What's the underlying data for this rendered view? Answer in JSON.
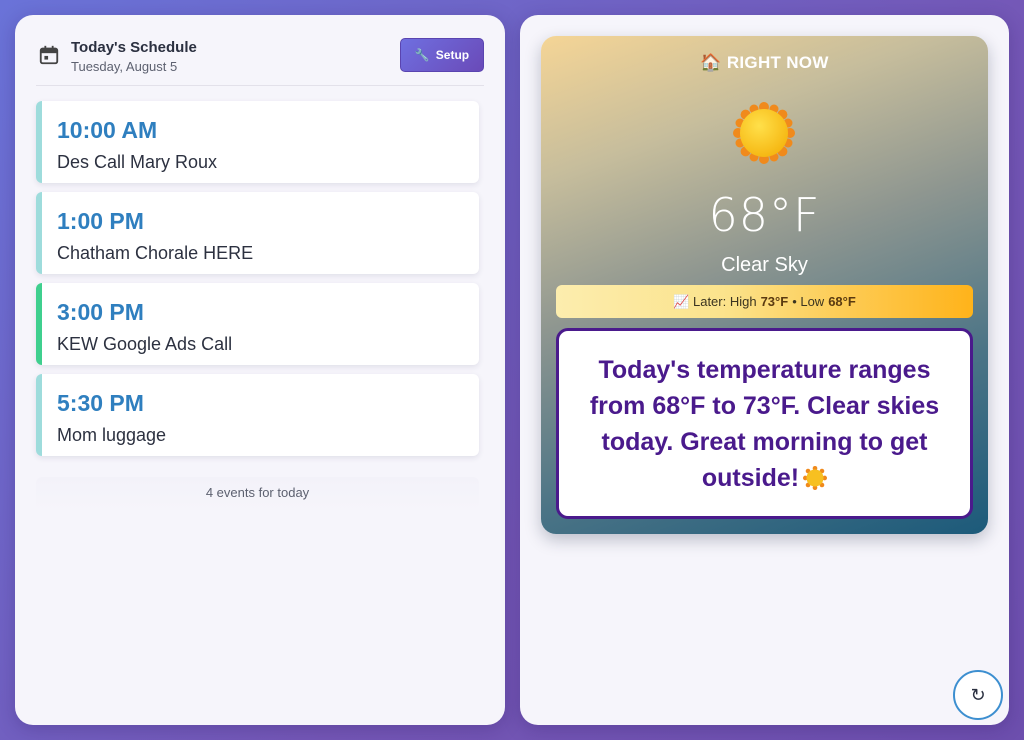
{
  "schedule": {
    "title": "Today's Schedule",
    "date": "Tuesday, August 5",
    "setup_label": "Setup",
    "events": [
      {
        "time": "10:00 AM",
        "title": "Des Call Mary Roux"
      },
      {
        "time": "1:00 PM",
        "title": "Chatham Chorale HERE"
      },
      {
        "time": "3:00 PM",
        "title": "KEW Google Ads Call"
      },
      {
        "time": "5:30 PM",
        "title": "Mom luggage"
      }
    ],
    "count_text": "4 events for today"
  },
  "weather": {
    "now_label": "🏠 RIGHT NOW",
    "temperature": "68°F",
    "condition": "Clear Sky",
    "later_prefix": "📈 Later: High",
    "later_high": "73°F",
    "later_sep": "• Low",
    "later_low": "68°F",
    "summary": "Today's temperature ranges from 68°F to 73°F. Clear skies today. Great morning to get outside!"
  },
  "refresh_label": "↻",
  "colors": {
    "accent": "#2f7fbf",
    "active_event": "#3fcf8e",
    "event_border": "#9edcdc",
    "summary_text": "#4a1a8c"
  },
  "icons": {
    "calendar": "calendar-icon",
    "setup": "wrench-icon",
    "sun": "sun-icon",
    "refresh": "refresh-icon"
  }
}
